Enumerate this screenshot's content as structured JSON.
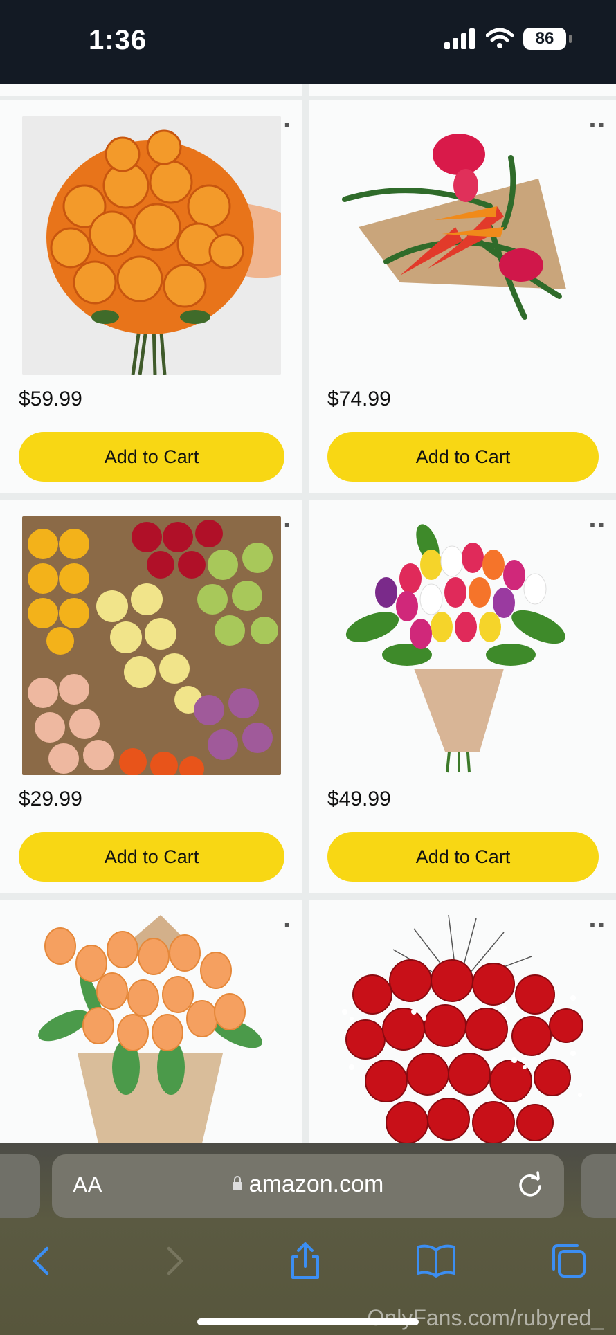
{
  "status_bar": {
    "time": "1:36",
    "battery": "86"
  },
  "products": [
    {
      "price": "$59.99",
      "button": "Add to Cart",
      "image": "orange-roses-bouquet"
    },
    {
      "price": "$74.99",
      "button": "Add to Cart",
      "image": "tropical-flowers-bouquet"
    },
    {
      "price": "$29.99",
      "button": "Add to Cart",
      "image": "assorted-roses-bunches"
    },
    {
      "price": "$49.99",
      "button": "Add to Cart",
      "image": "mixed-tulips-bouquet"
    },
    {
      "price": "",
      "button": "",
      "image": "orange-tulips-bouquet"
    },
    {
      "price": "",
      "button": "",
      "image": "red-roses-babys-breath"
    }
  ],
  "more_icon": "…",
  "browser": {
    "aa": "AA",
    "url": "amazon.com"
  },
  "watermark": "OnlyFans.com/rubyred_",
  "colors": {
    "cart_button": "#f8d714",
    "status_bar": "#131a24",
    "toolbar_blue": "#3c8ef2"
  }
}
